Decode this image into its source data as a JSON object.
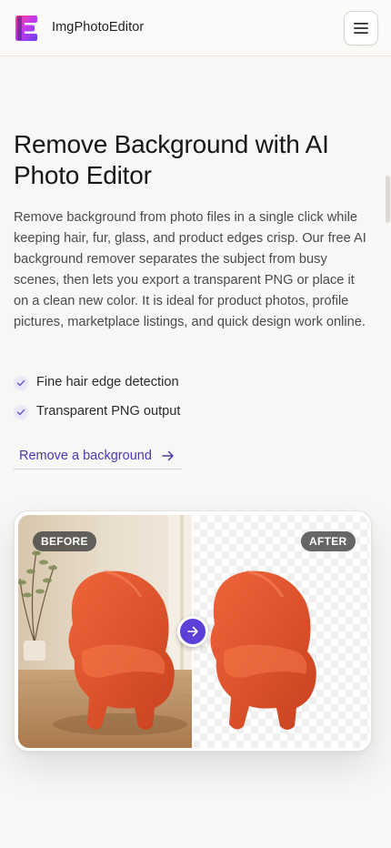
{
  "header": {
    "brand": "ImgPhotoEditor",
    "logo_icon": "letter-e-logo",
    "menu_icon": "hamburger-menu-icon"
  },
  "hero": {
    "title": "Remove Background with AI Photo Editor",
    "description": "Remove background from photo files in a single click while keeping hair, fur, glass, and product edges crisp. Our free AI background remover separates the subject from busy scenes, then lets you export a transparent PNG or place it on a clean new color. It is ideal for product photos, profile pictures, marketplace listings, and quick design work online.",
    "features": [
      {
        "label": "Fine hair edge detection",
        "icon": "check-icon"
      },
      {
        "label": "Transparent PNG output",
        "icon": "check-icon"
      }
    ],
    "cta": {
      "label": "Remove a background",
      "icon": "arrow-right-icon"
    }
  },
  "comparison": {
    "before_label": "BEFORE",
    "after_label": "AFTER",
    "handle_icon": "arrow-right-icon",
    "slider_position_fraction": 0.5
  },
  "colors": {
    "accent": "#5b3fd8",
    "link": "#4b39b8",
    "chair": "#e0512a",
    "background": "#f8f7f5"
  }
}
